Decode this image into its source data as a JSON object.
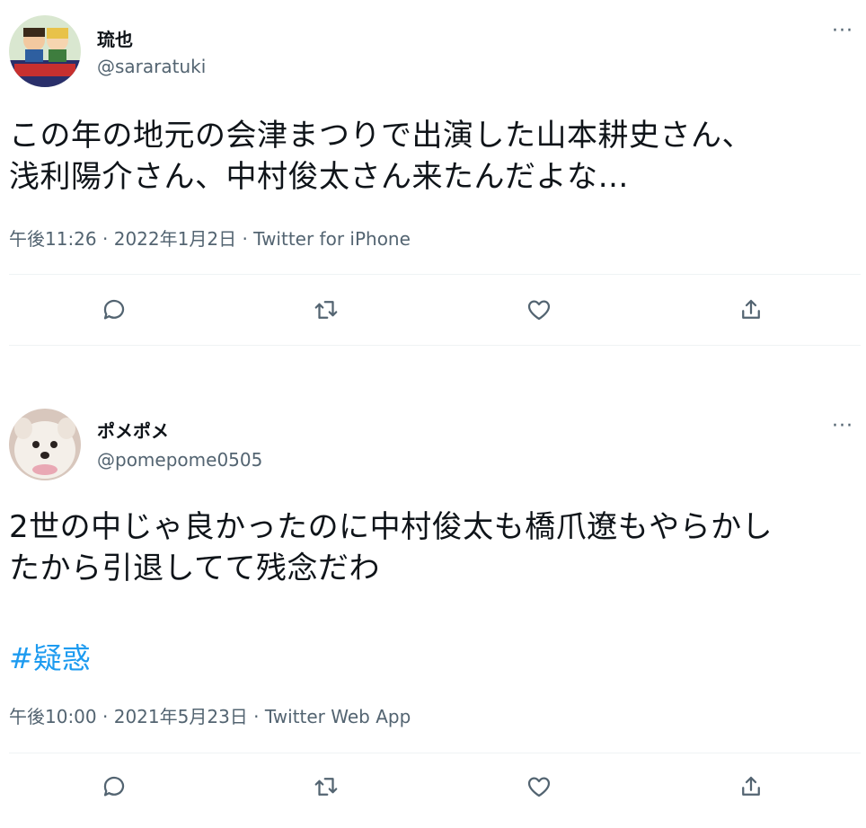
{
  "tweets": [
    {
      "display_name": "琉也",
      "handle": "@sararatuki",
      "text_line1": "この年の地元の会津まつりで出演した山本耕史さん、",
      "text_line2": "浅利陽介さん、中村俊太さん来たんだよな…",
      "hashtag": "",
      "time": "午後11:26",
      "date": "2022年1月2日",
      "source": "Twitter for iPhone",
      "sep": "·"
    },
    {
      "display_name": "ポメポメ",
      "handle": "@pomepome0505",
      "text_line1": "2世の中じゃ良かったのに中村俊太も橋爪遼もやらかし",
      "text_line2": "たから引退してて残念だわ",
      "hashtag": "#疑惑",
      "time": "午後10:00",
      "date": "2021年5月23日",
      "source": "Twitter Web App",
      "sep": "·"
    }
  ],
  "ui": {
    "more_label": "···"
  },
  "colors": {
    "text": "#0f1419",
    "secondary": "#536471",
    "link": "#1d9bf0",
    "divider": "#eff3f4"
  },
  "icons": [
    "reply-icon",
    "retweet-icon",
    "like-icon",
    "share-icon",
    "more-icon"
  ]
}
